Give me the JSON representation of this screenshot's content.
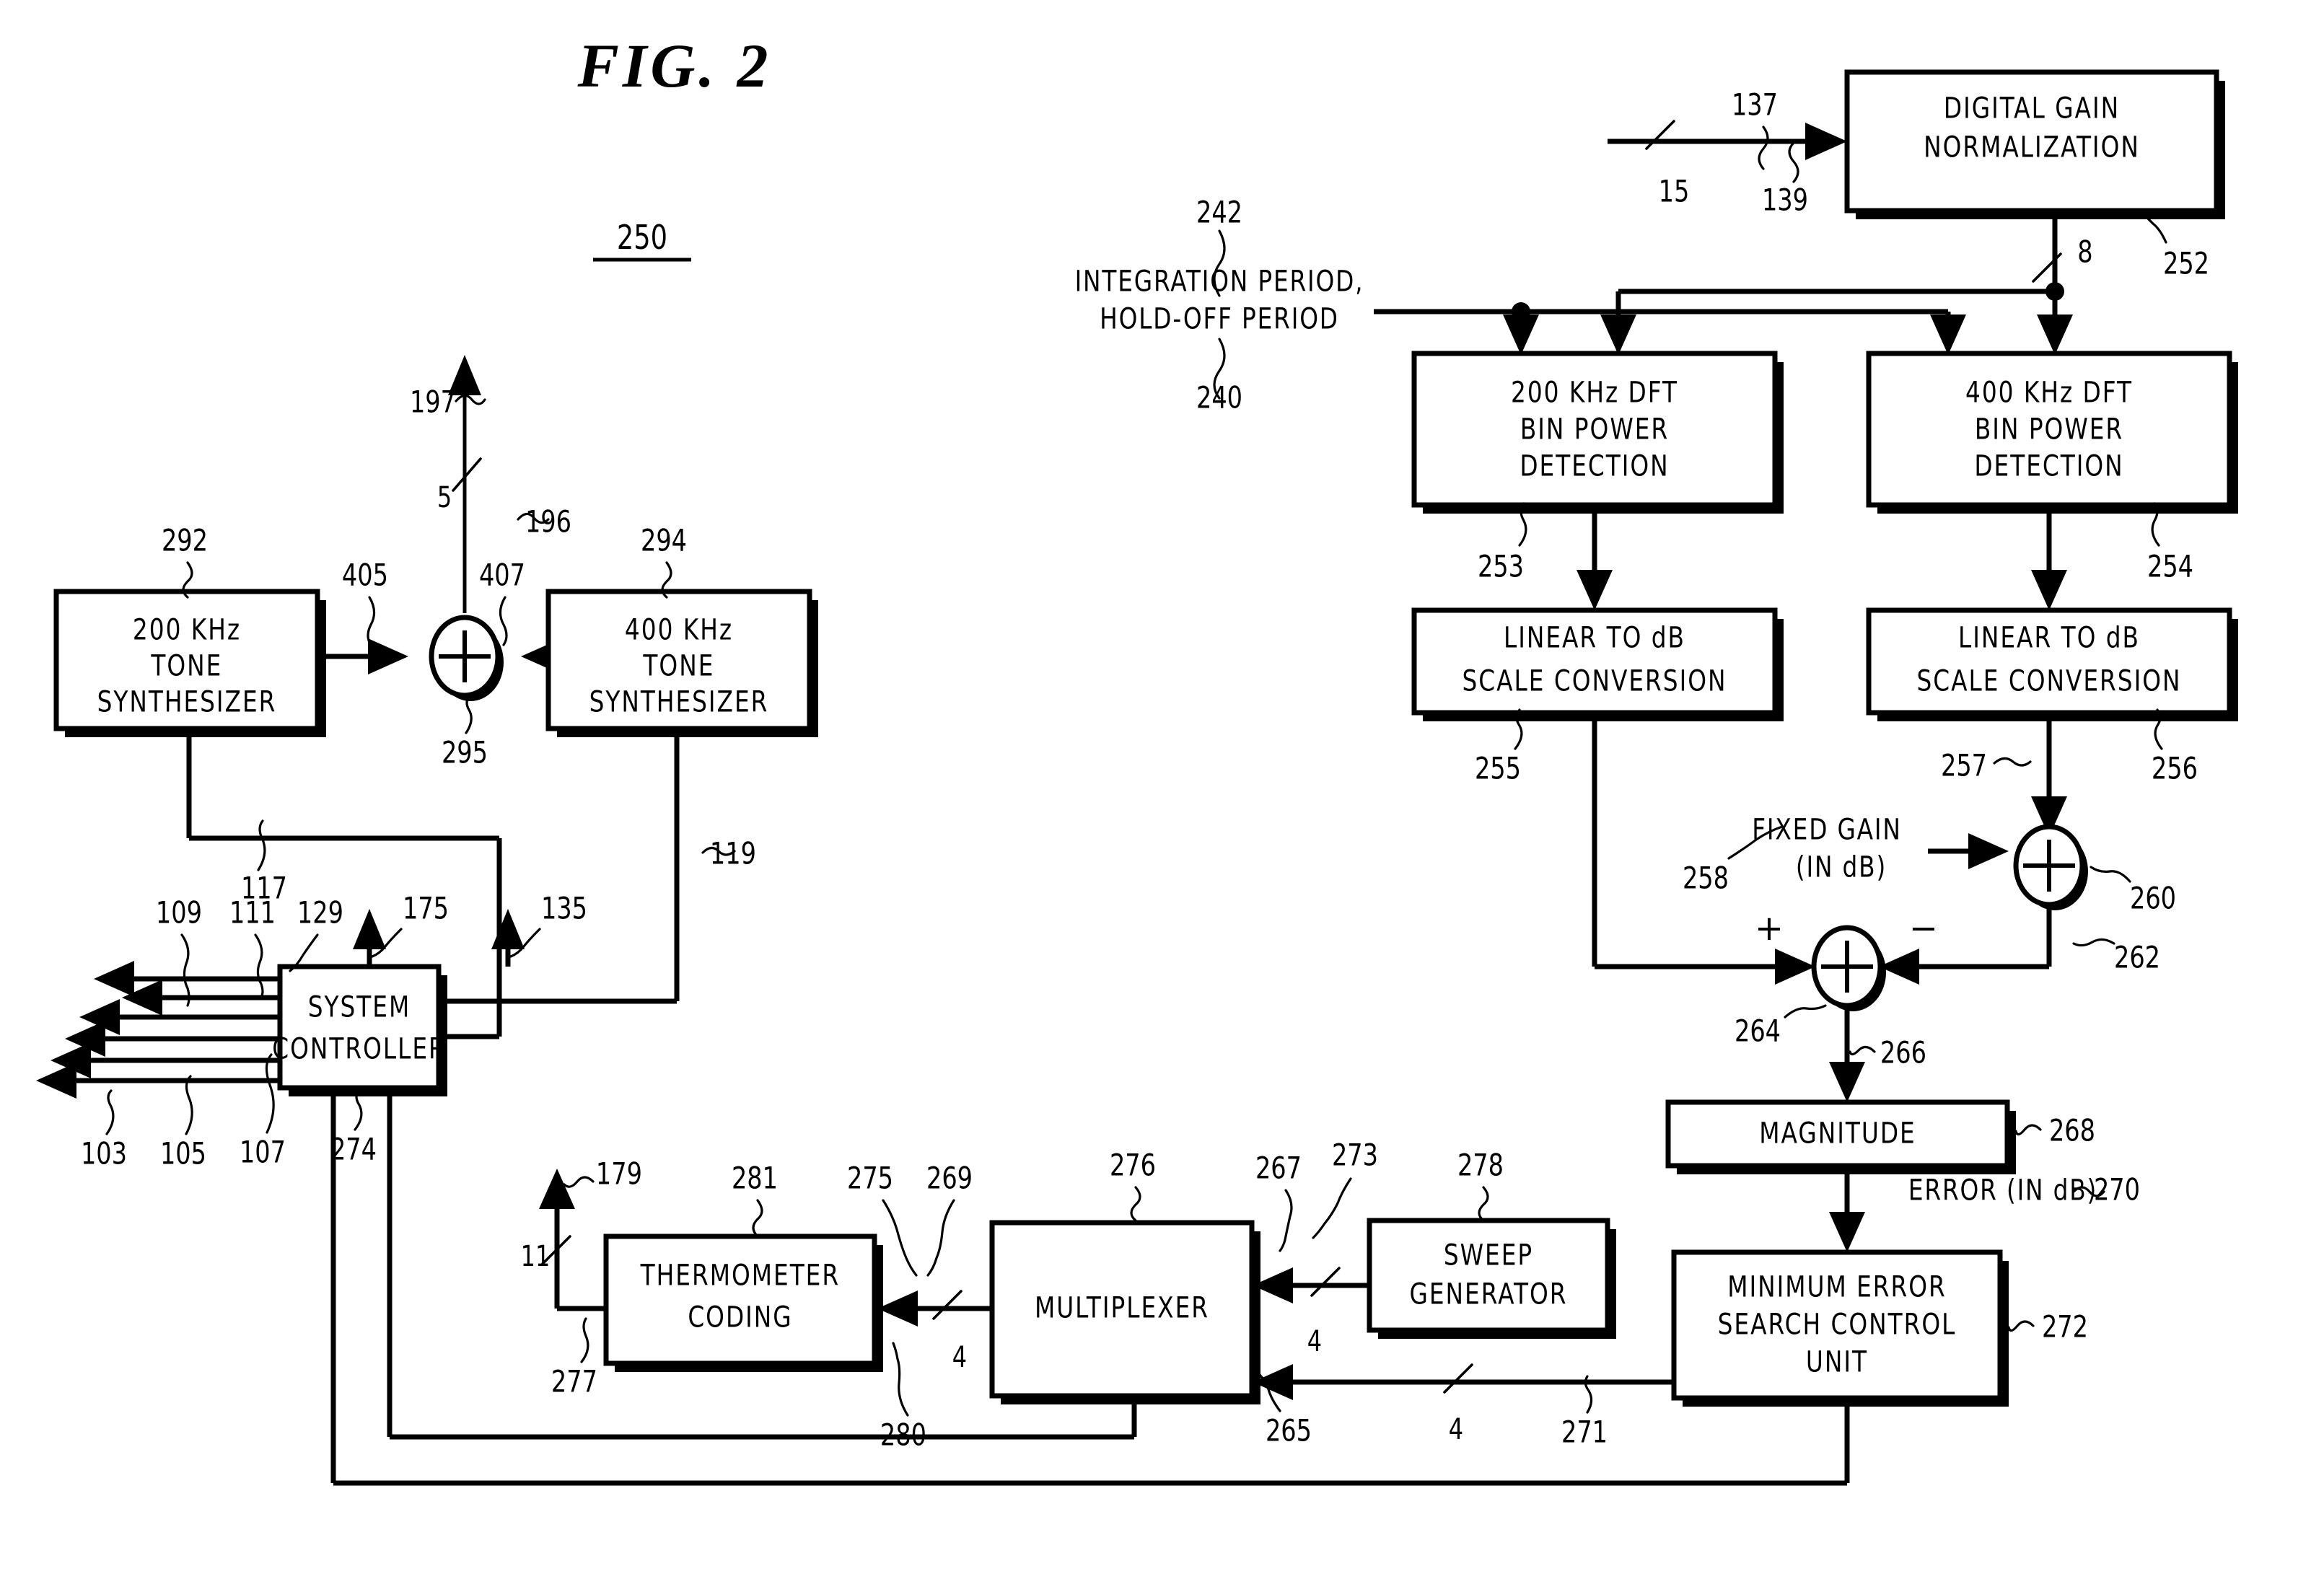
{
  "figure": {
    "title": "FIG. 2",
    "figure_ref": "250"
  },
  "blocks": {
    "digital_gain_normalization": {
      "line1": "DIGITAL GAIN",
      "line2": "NORMALIZATION",
      "ref": "252"
    },
    "dft_200": {
      "line1": "200 KHz DFT",
      "line2": "BIN POWER",
      "line3": "DETECTION",
      "ref": "253"
    },
    "dft_400": {
      "line1": "400 KHz DFT",
      "line2": "BIN POWER",
      "line3": "DETECTION",
      "ref": "254"
    },
    "lin_db_left": {
      "line1": "LINEAR TO dB",
      "line2": "SCALE CONVERSION",
      "ref": "255"
    },
    "lin_db_right": {
      "line1": "LINEAR TO dB",
      "line2": "SCALE CONVERSION",
      "ref": "256"
    },
    "magnitude": {
      "line1": "MAGNITUDE",
      "ref": "268"
    },
    "min_error": {
      "line1": "MINIMUM ERROR",
      "line2": "SEARCH CONTROL",
      "line3": "UNIT",
      "ref": "272"
    },
    "sweep_generator": {
      "line1": "SWEEP",
      "line2": "GENERATOR",
      "ref": "278"
    },
    "multiplexer": {
      "line1": "MULTIPLEXER",
      "ref": "276"
    },
    "thermometer_coding": {
      "line1": "THERMOMETER",
      "line2": "CODING",
      "ref": "281"
    },
    "system_controller": {
      "line1": "SYSTEM",
      "line2": "CONTROLLER"
    },
    "tone_200": {
      "line1": "200 KHz",
      "line2": "TONE",
      "line3": "SYNTHESIZER",
      "ref": "292"
    },
    "tone_400": {
      "line1": "400 KHz",
      "line2": "TONE",
      "line3": "SYNTHESIZER",
      "ref": "294"
    }
  },
  "annotations": {
    "integration_hold_off_l1": "INTEGRATION PERIOD,",
    "integration_hold_off_l2": "HOLD-OFF PERIOD",
    "integration_ref_top": "242",
    "integration_ref_bottom": "240",
    "fixed_gain_l1": "FIXED GAIN",
    "fixed_gain_l2": "(IN dB)",
    "fixed_gain_ref": "258",
    "error_in_db": "ERROR (IN dB)",
    "error_in_db_ref": "270",
    "plus_sign": "+",
    "minus_sign": "−"
  },
  "refs": {
    "in_15": "15",
    "in_137": "137",
    "in_139": "139",
    "bus_8": "8",
    "sum_260": "260",
    "line_257": "257",
    "line_262": "262",
    "sum_264": "264",
    "line_266": "266",
    "line_271": "271",
    "line_265": "265",
    "line_267": "267",
    "line_273": "273",
    "line_269": "269",
    "line_275": "275",
    "line_280": "280",
    "line_277": "277",
    "line_179": "179",
    "bus_11": "11",
    "bus_4a": "4",
    "bus_4b": "4",
    "bus_4c": "4",
    "line_274": "274",
    "out_103": "103",
    "out_105": "105",
    "out_107": "107",
    "out_109": "109",
    "out_111": "111",
    "out_129": "129",
    "out_175": "175",
    "out_135": "135",
    "line_117": "117",
    "line_119": "119",
    "line_405": "405",
    "line_407": "407",
    "sum_295": "295",
    "line_196": "196",
    "line_197": "197",
    "bus_5": "5"
  }
}
